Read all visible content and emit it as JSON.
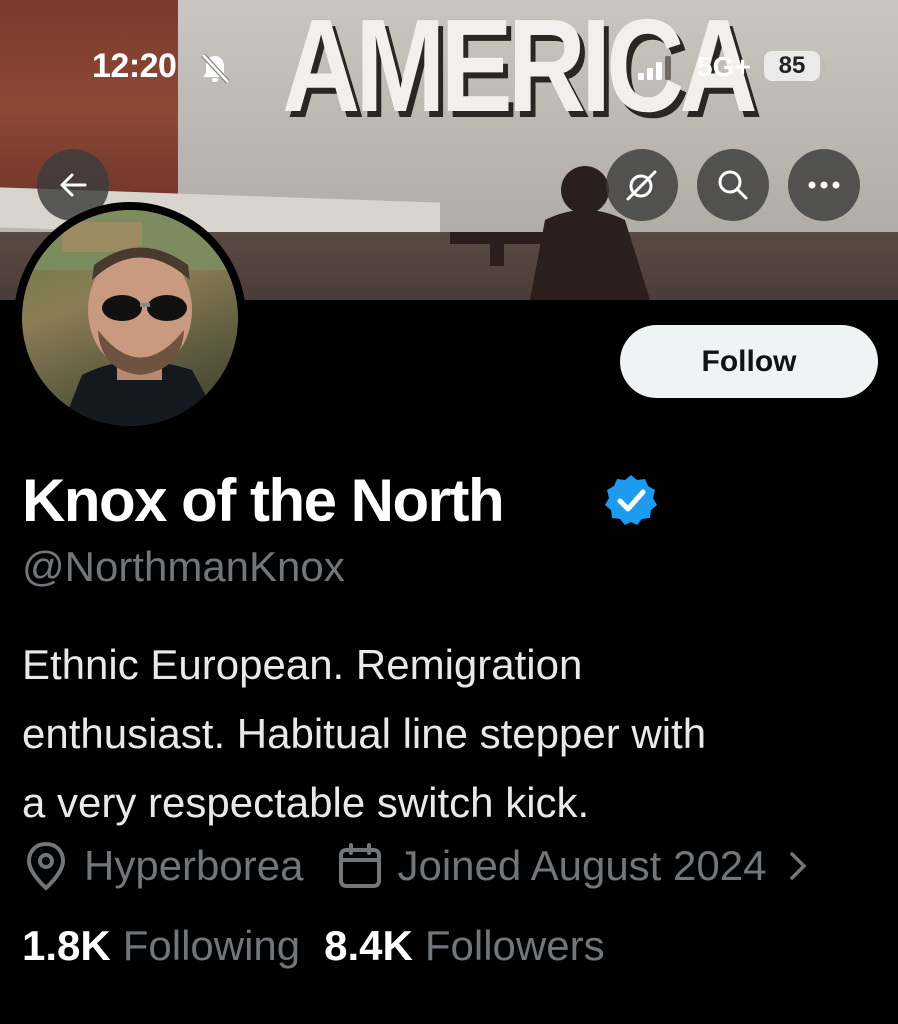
{
  "status_bar": {
    "time": "12:20",
    "network": "5G+",
    "battery": "85",
    "icons": [
      "bell-slash-icon",
      "signal-icon"
    ]
  },
  "banner": {
    "sign_text": "AMERICA"
  },
  "header": {
    "icons": [
      "back-arrow-icon",
      "grok-icon",
      "search-icon",
      "more-icon"
    ]
  },
  "profile": {
    "follow_label": "Follow",
    "display_name": "Knox of the North",
    "handle": "@NorthmanKnox",
    "bio_lines": [
      "Ethnic European. Remigration",
      "enthusiast. Habitual line stepper with",
      "a very respectable switch kick."
    ],
    "location": "Hyperborea",
    "joined": "Joined August 2024",
    "following_count": "1.8K",
    "following_label": "Following",
    "followers_count": "8.4K",
    "followers_label": "Followers",
    "badge_color": "#1d9bf0"
  }
}
